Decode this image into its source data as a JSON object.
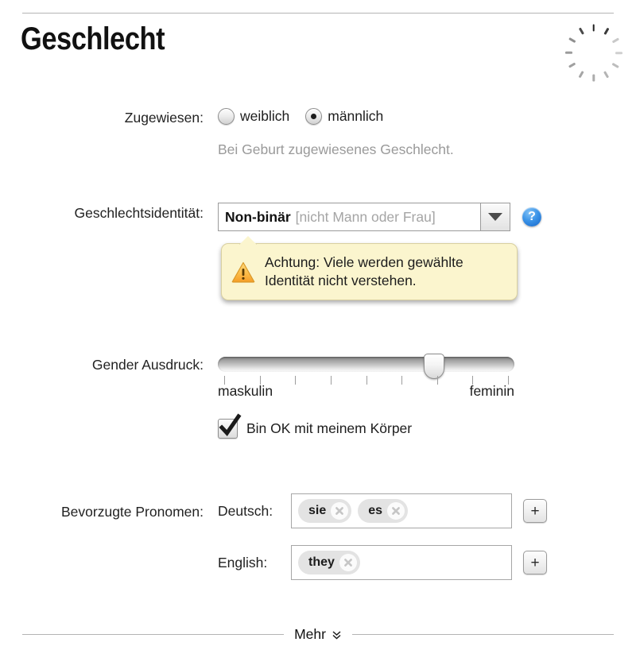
{
  "header": {
    "title": "Geschlecht",
    "spinner_name": "loading-spinner"
  },
  "assigned": {
    "label": "Zugewiesen:",
    "options": [
      {
        "label": "weiblich",
        "selected": false
      },
      {
        "label": "männlich",
        "selected": true
      }
    ],
    "hint": "Bei Geburt zugewiesenes Geschlecht."
  },
  "identity": {
    "label": "Geschlechtsidentität:",
    "value": "Non-binär",
    "value_note": "[nicht Mann oder Frau]",
    "dropdown_icon": "chevron-down-icon",
    "help_icon": "help-icon",
    "help_glyph": "?"
  },
  "tooltip": {
    "icon": "warning-triangle-icon",
    "line1": "Achtung: Viele werden gewählte",
    "line2": "Identität nicht verstehen.",
    "background": "#fbf5ce",
    "border": "#d9d0a0"
  },
  "expression": {
    "label": "Gender Ausdruck:",
    "min_label": "maskulin",
    "max_label": "feminin",
    "value_percent": 73,
    "tick_count": 9
  },
  "body_ok": {
    "label": "Bin OK mit meinem Körper",
    "checked": true
  },
  "pronouns": {
    "label": "Bevorzugte Pronomen:",
    "groups": [
      {
        "sublabel": "Deutsch:",
        "tokens": [
          "sie",
          "es"
        ],
        "add_label": "+"
      },
      {
        "sublabel": "English:",
        "tokens": [
          "they"
        ],
        "add_label": "+"
      }
    ]
  },
  "footer": {
    "more_label": "Mehr",
    "chevron_icon": "double-chevron-down-icon"
  }
}
